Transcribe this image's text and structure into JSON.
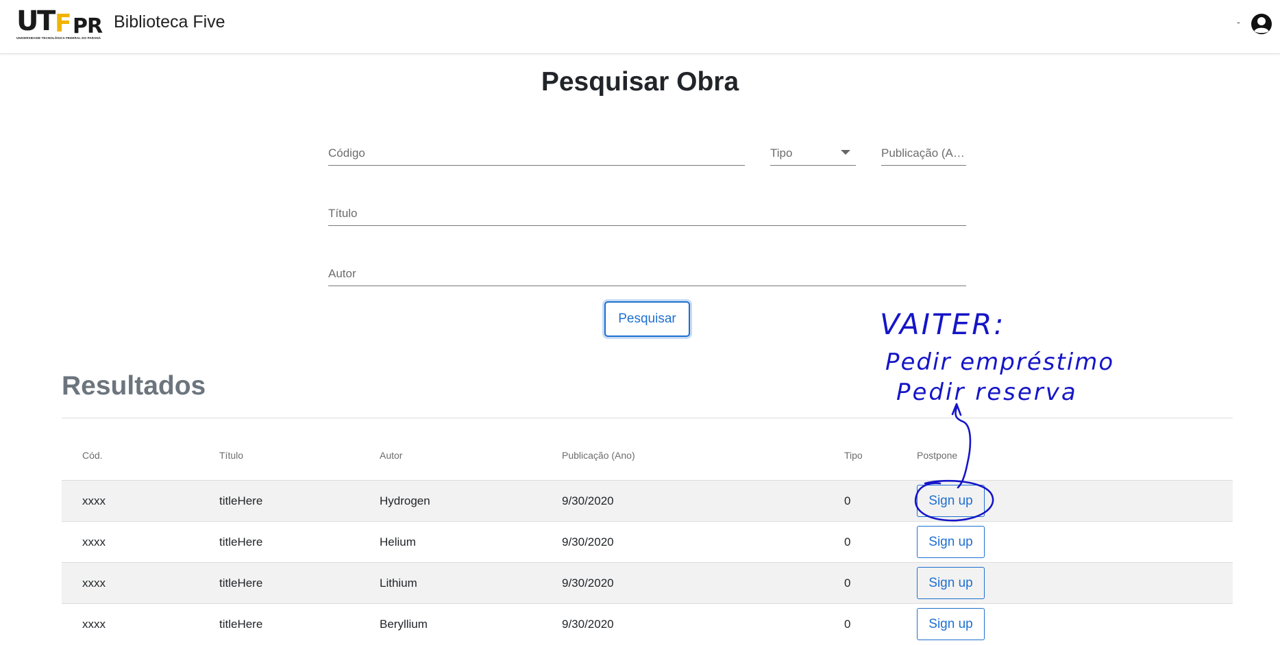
{
  "header": {
    "logo_text": "UTFPR",
    "logo_subtitle": "UNIVERSIDADE TECNOLÓGICA FEDERAL DO PARANÁ",
    "app_title": "Biblioteca Five",
    "user_label": "-"
  },
  "form": {
    "title": "Pesquisar Obra",
    "codigo_placeholder": "Código",
    "tipo_placeholder": "Tipo",
    "publicacao_placeholder": "Publicação (Ano)",
    "titulo_placeholder": "Título",
    "autor_placeholder": "Autor",
    "search_button": "Pesquisar"
  },
  "results": {
    "title": "Resultados",
    "columns": [
      "Cód.",
      "Título",
      "Autor",
      "Publicação (Ano)",
      "Tipo",
      "Postpone"
    ],
    "rows": [
      {
        "cod": "xxxx",
        "titulo": "titleHere",
        "autor": "Hydrogen",
        "publicacao": "9/30/2020",
        "tipo": "0",
        "action": "Sign up"
      },
      {
        "cod": "xxxx",
        "titulo": "titleHere",
        "autor": "Helium",
        "publicacao": "9/30/2020",
        "tipo": "0",
        "action": "Sign up"
      },
      {
        "cod": "xxxx",
        "titulo": "titleHere",
        "autor": "Lithium",
        "publicacao": "9/30/2020",
        "tipo": "0",
        "action": "Sign up"
      },
      {
        "cod": "xxxx",
        "titulo": "titleHere",
        "autor": "Beryllium",
        "publicacao": "9/30/2020",
        "tipo": "0",
        "action": "Sign up"
      }
    ]
  },
  "annotation": {
    "line1": "VAITER:",
    "line2": "Pedir empréstimo",
    "line3": "Pedir reserva",
    "ink_color": "#1515c8"
  },
  "colors": {
    "primary": "#1e6fd0",
    "logo_accent": "#f0b400",
    "stripe": "#f2f2f2"
  }
}
